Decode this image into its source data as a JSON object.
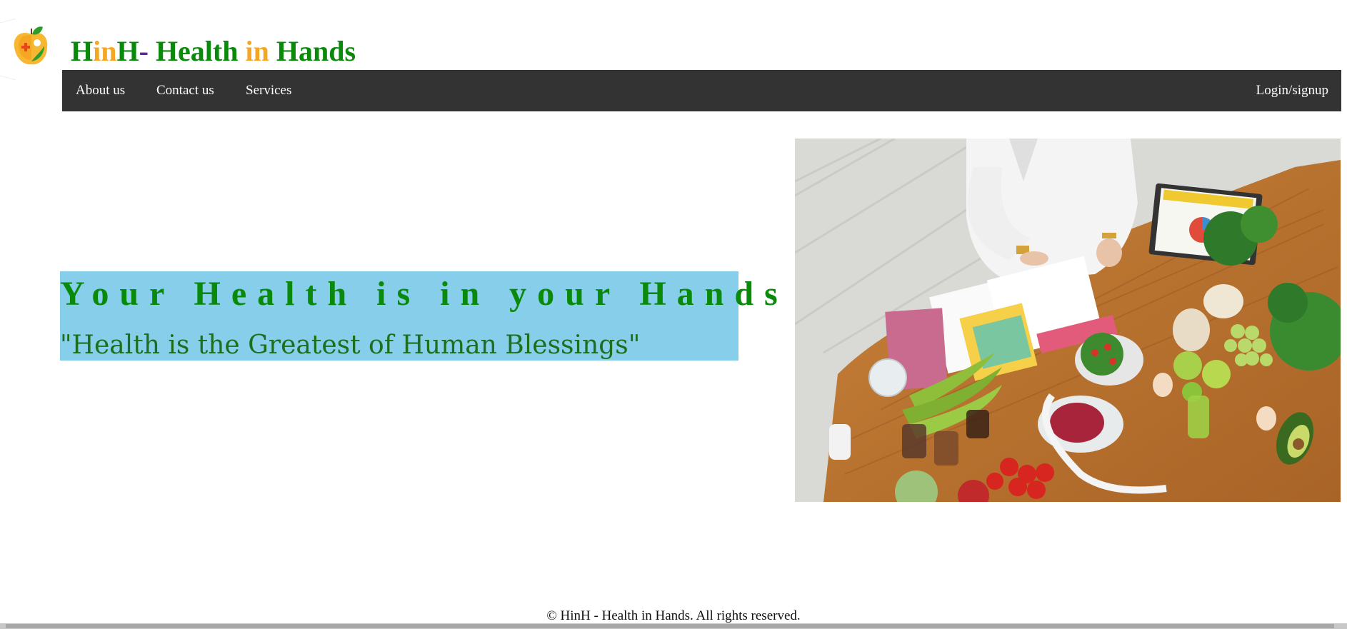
{
  "header": {
    "brand": {
      "part1": "H",
      "part2": "in",
      "part3": "H",
      "part4": "-",
      "part5": " Health ",
      "part6": "in",
      "part7": " Hands"
    },
    "logo_icon": "apple-medical-cross-icon"
  },
  "nav": {
    "about": "About us",
    "contact": "Contact us",
    "services": "Services",
    "login": "Login/signup"
  },
  "hero": {
    "title": "Your Health is in your Hands",
    "quote": "\"Health is the Greatest of Human Blessings\"",
    "image_subject": "healthy-food-table-illustration"
  },
  "footer": {
    "text": "© HinH - Health in Hands. All rights reserved."
  },
  "colors": {
    "green": "#0a8a0a",
    "orange": "#f5a623",
    "purple": "#5b2b8f",
    "navbar": "#333333",
    "hero_box": "#87ceeb"
  }
}
